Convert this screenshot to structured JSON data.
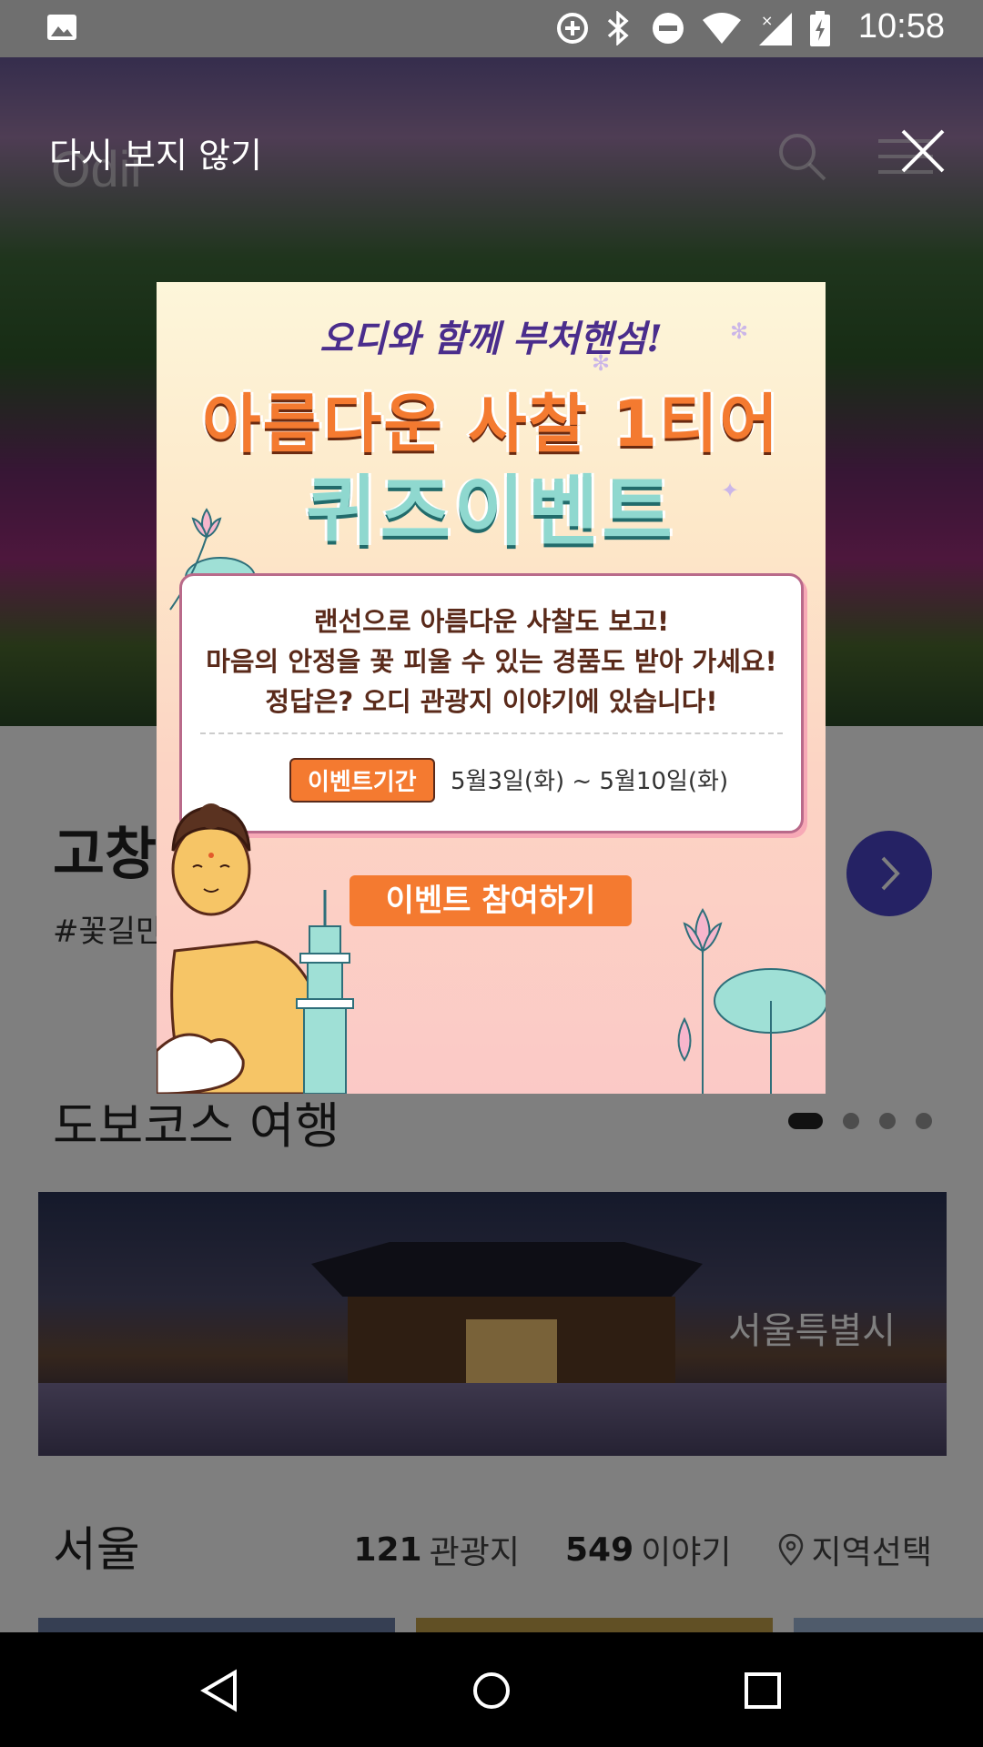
{
  "status_bar": {
    "time": "10:58",
    "icons": [
      "image-icon",
      "data-saver-icon",
      "bluetooth-icon",
      "do-not-disturb-icon",
      "wifi-icon",
      "signal-icon",
      "battery-charging-icon"
    ]
  },
  "hero": {
    "logo_text": "Odii"
  },
  "overlay": {
    "dont_show_again": "다시 보지 않기"
  },
  "popup": {
    "subtitle": "오디와 함께 부처핸섬!",
    "title_line1": "아름다운 사찰 1티어",
    "title_line2": "퀴즈이벤트",
    "body_line1": "랜선으로 아름다운 사찰도 보고!",
    "body_line2": "마음의 안정을 꽃 피울 수 있는 경품도 받아 가세요!",
    "body_line3": "정답은? 오디 관광지 이야기에 있습니다!",
    "period_label": "이벤트기간",
    "period_value": "5월3일(화) ~ 5월10일(화)",
    "cta_label": "이벤트 참여하기"
  },
  "featured": {
    "title": "고창",
    "tags": "#꽃길만"
  },
  "walking_course": {
    "section_title": "도보코스 여행",
    "region_label": "서울특별시",
    "page_count": 4,
    "active_page": 1
  },
  "region": {
    "name": "서울",
    "attractions_count": "121",
    "attractions_label": "관광지",
    "stories_count": "549",
    "stories_label": "이야기",
    "select_label": "지역선택"
  },
  "colors": {
    "accent": "#4a45c8",
    "popup_orange": "#f47a30",
    "popup_mint": "#8fd8cf"
  }
}
